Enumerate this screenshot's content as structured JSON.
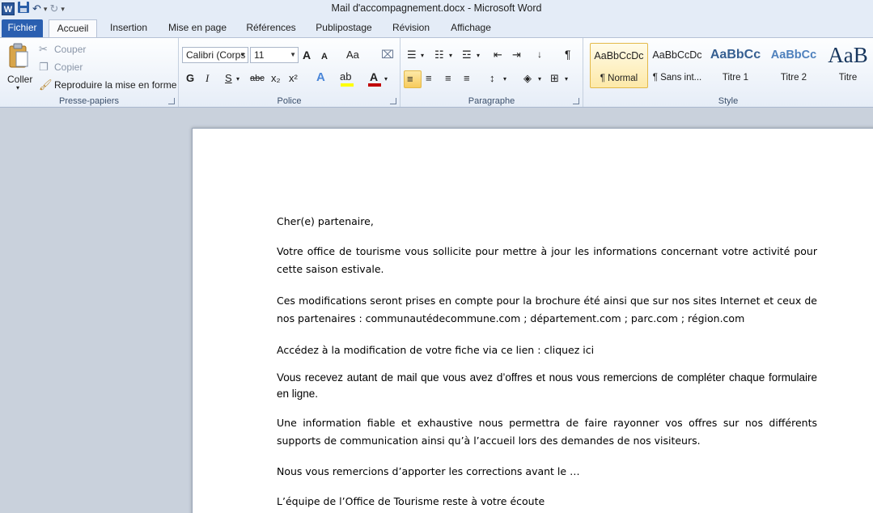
{
  "window": {
    "title": "Mail d'accompagnement.docx  -  Microsoft Word"
  },
  "qat": {
    "app_icon": "W",
    "save_icon": "floppy-disk-icon",
    "undo_icon": "undo-icon",
    "redo_icon": "redo-icon"
  },
  "tabs": [
    {
      "label": "Fichier"
    },
    {
      "label": "Accueil"
    },
    {
      "label": "Insertion"
    },
    {
      "label": "Mise en page"
    },
    {
      "label": "Références"
    },
    {
      "label": "Publipostage"
    },
    {
      "label": "Révision"
    },
    {
      "label": "Affichage"
    }
  ],
  "clipboard": {
    "paste": "Coller",
    "cut": "Couper",
    "copy": "Copier",
    "format_painter": "Reproduire la mise en forme",
    "label": "Presse-papiers"
  },
  "font": {
    "name": "Calibri (Corps",
    "size": "11",
    "label": "Police",
    "bold": "G",
    "italic": "I",
    "underline": "S",
    "strike": "abc",
    "subscript": "x₂",
    "superscript": "x²",
    "grow": "A",
    "shrink": "A",
    "case": "Aa",
    "color_accent": "#c00000",
    "highlight_accent": "#ffff00"
  },
  "paragraph": {
    "label": "Paragraphe",
    "pilcrow": "¶"
  },
  "styles": {
    "label": "Style",
    "items": [
      {
        "sample": "AaBbCcDc",
        "name": "¶ Normal"
      },
      {
        "sample": "AaBbCcDc",
        "name": "¶ Sans int..."
      },
      {
        "sample": "AaBbCc",
        "name": "Titre 1"
      },
      {
        "sample": "AaBbCc",
        "name": "Titre 2"
      },
      {
        "sample": "AaB",
        "name": "Titre"
      }
    ]
  },
  "document": {
    "p1": "Cher(e) partenaire,",
    "p2": "Votre office de tourisme vous sollicite pour mettre à jour les informations concernant votre activité pour cette saison estivale.",
    "p3": "Ces modifications seront prises en compte pour la brochure été ainsi que sur nos sites Internet et ceux de nos partenaires : communautédecommune.com  ; département.com ; parc.com ; région.com",
    "p4": "Accédez à la modification de votre fiche via ce lien : cliquez ici",
    "p5": "Vous recevez autant de mail que vous avez d’offres et nous vous remercions de compléter chaque formulaire en ligne.",
    "p6": "Une information fiable et exhaustive nous permettra de faire rayonner vos offres sur nos différents supports de communication ainsi qu’à l’accueil lors des demandes de nos visiteurs.",
    "p7": "Nous vous remercions d’apporter les corrections avant le …",
    "p8": "L’équipe de l’Office de Tourisme reste à votre écoute"
  }
}
